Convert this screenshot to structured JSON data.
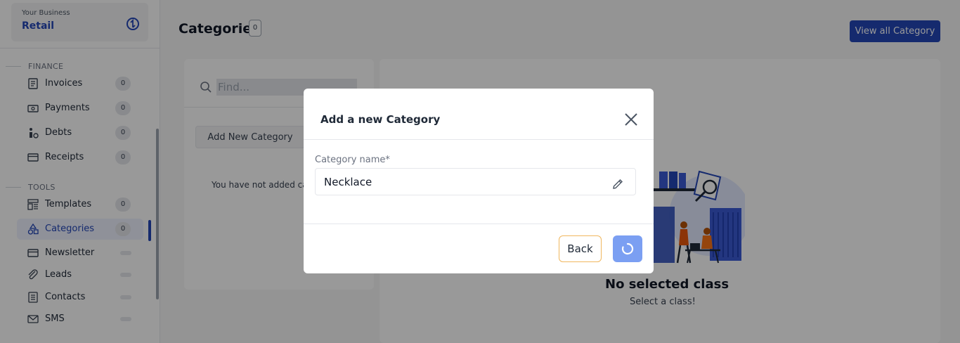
{
  "business": {
    "label": "Your Business",
    "name": "Retail"
  },
  "sidebar": {
    "finance_label": "FINANCE",
    "tools_label": "TOOLS",
    "finance_items": [
      {
        "label": "Invoices",
        "count": "0",
        "icon": "invoice-icon"
      },
      {
        "label": "Payments",
        "count": "0",
        "icon": "payments-icon"
      },
      {
        "label": "Debts",
        "count": "0",
        "icon": "debts-icon"
      },
      {
        "label": "Receipts",
        "count": "0",
        "icon": "receipt-icon"
      }
    ],
    "tool_items": [
      {
        "label": "Templates",
        "count": "0",
        "icon": "templates-icon"
      },
      {
        "label": "Categories",
        "count": "0",
        "icon": "categories-icon",
        "active": true
      },
      {
        "label": "Newsletter",
        "count": "",
        "icon": "newsletter-icon"
      },
      {
        "label": "Leads",
        "count": "",
        "icon": "leads-icon"
      },
      {
        "label": "Contacts",
        "count": "",
        "icon": "contacts-icon"
      },
      {
        "label": "SMS",
        "count": "",
        "icon": "sms-icon"
      }
    ]
  },
  "header": {
    "title": "Categories",
    "count": "0",
    "view_all_label": "View all Category"
  },
  "left_panel": {
    "search_placeholder": "Find...",
    "add_button_label": "Add New Category",
    "empty_text": "You have not added ca"
  },
  "right_panel": {
    "empty_title": "No selected class",
    "empty_subtitle": "Select a class!"
  },
  "modal": {
    "title": "Add a new Category",
    "field_label": "Category name*",
    "field_value": "Necklace",
    "back_label": "Back"
  },
  "colors": {
    "accent": "#2446b8",
    "submit_loading": "#7b9ff2",
    "back_border": "#f0b75e",
    "overlay": "rgba(0,0,0,0.40)"
  }
}
